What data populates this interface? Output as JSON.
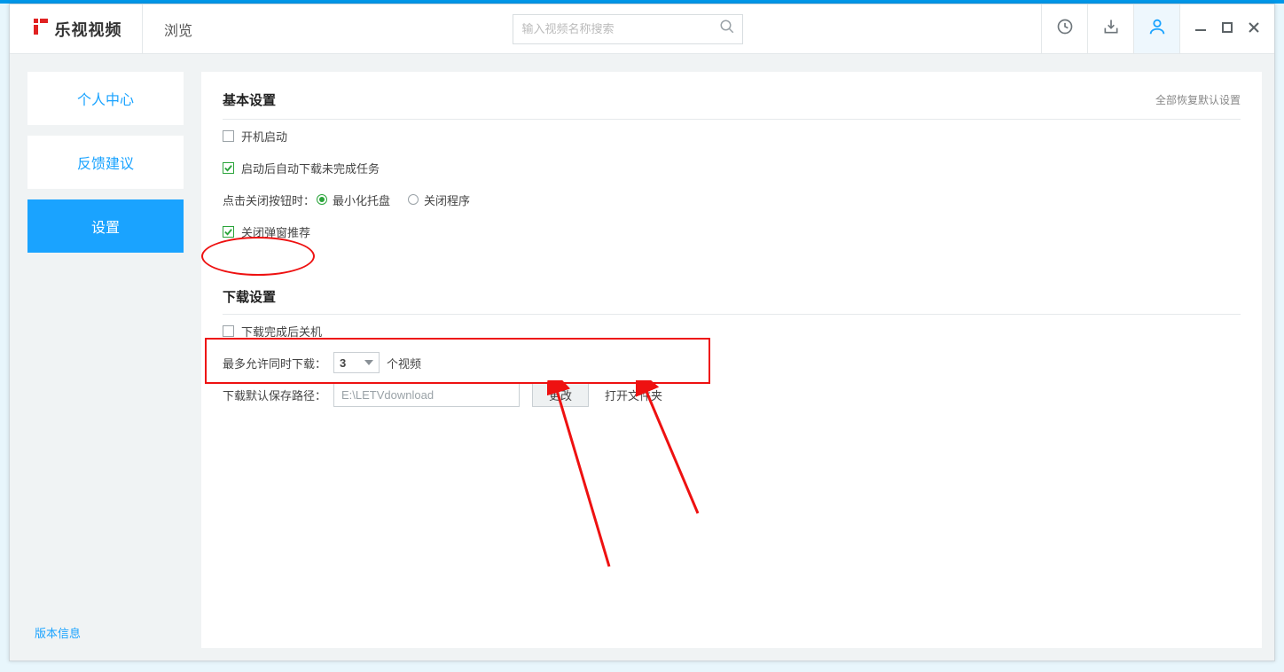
{
  "titlebar": {
    "app_name": "乐视视频",
    "browse_label": "浏览",
    "search_placeholder": "输入视频名称搜索"
  },
  "sidebar": {
    "items": [
      {
        "label": "个人中心"
      },
      {
        "label": "反馈建议"
      },
      {
        "label": "设置"
      }
    ],
    "version_label": "版本信息"
  },
  "basic": {
    "title": "基本设置",
    "reset_label": "全部恢复默认设置",
    "autostart_label": "开机启动",
    "resume_dl_label": "启动后自动下载未完成任务",
    "close_action_prefix": "点击关闭按钮时：",
    "close_tray_label": "最小化托盘",
    "close_exit_label": "关闭程序",
    "popup_off_label": "关闭弹窗推荐"
  },
  "download": {
    "title": "下载设置",
    "shutdown_label": "下载完成后关机",
    "max_dl_prefix": "最多允许同时下载：",
    "max_dl_value": "3",
    "max_dl_suffix": "个视频",
    "path_prefix": "下载默认保存路径：",
    "path_value": "E:\\LETVdownload",
    "change_btn": "更改",
    "open_folder": "打开文件夹"
  }
}
